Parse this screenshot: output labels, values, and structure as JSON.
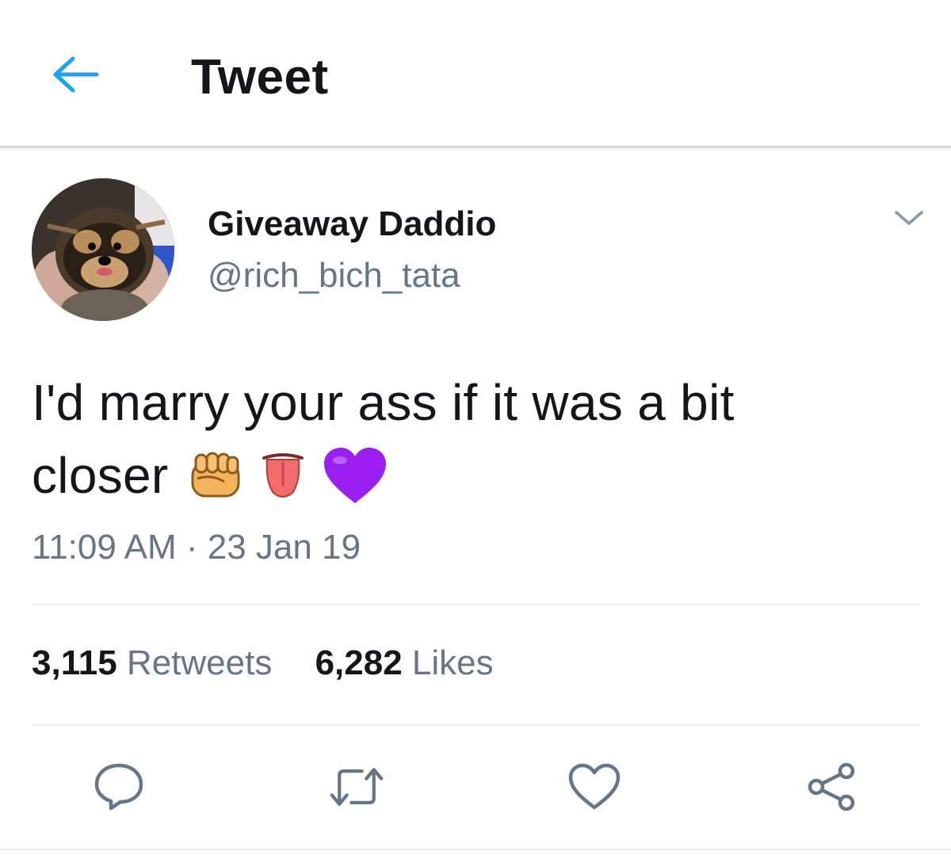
{
  "header": {
    "title": "Tweet",
    "accent_color": "#1da1f2"
  },
  "author": {
    "display_name": "Giveaway Daddio",
    "handle": "@rich_bich_tata"
  },
  "tweet": {
    "text_line1": "I'd marry your ass if it was a bit",
    "text_line2": "closer",
    "emojis": [
      "raised-fist-emoji",
      "tongue-emoji",
      "purple-heart-emoji"
    ],
    "time": "11:09 AM",
    "separator": "·",
    "date": "23 Jan 19"
  },
  "stats": {
    "retweets_count": "3,115",
    "retweets_label": "Retweets",
    "likes_count": "6,282",
    "likes_label": "Likes"
  },
  "actions": [
    "reply-icon",
    "retweet-icon",
    "like-icon",
    "share-icon"
  ],
  "colors": {
    "text": "#14171a",
    "secondary": "#657786",
    "divider": "#e6ecf0",
    "purple_heart": "#9b1ff0"
  }
}
